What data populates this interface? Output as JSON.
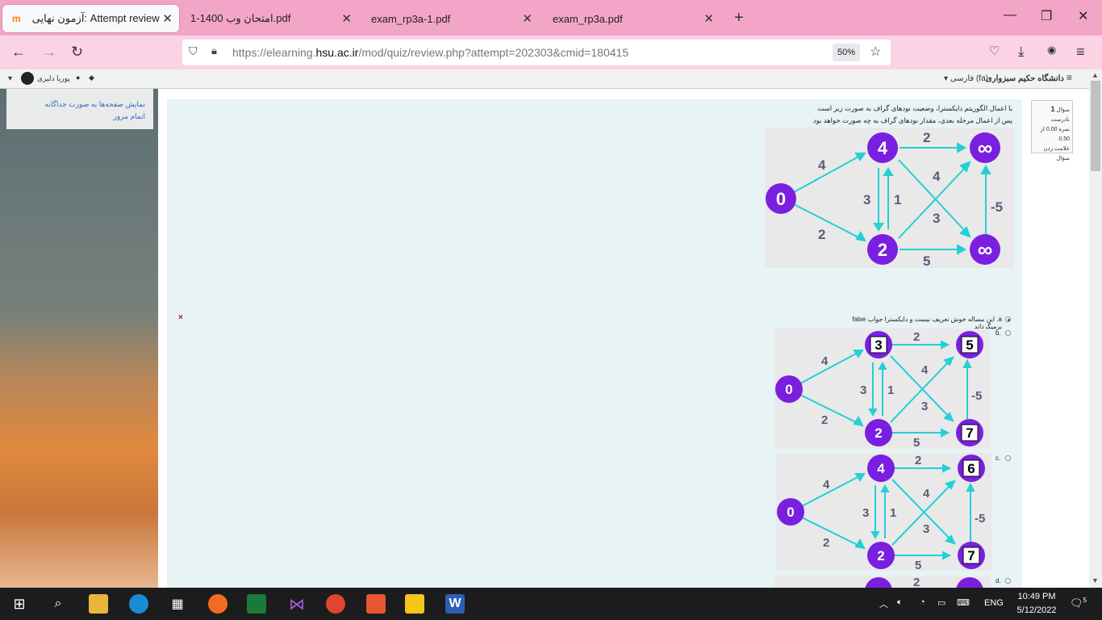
{
  "browser": {
    "tabs": [
      {
        "title": "Attempt review :آزمون نهایی",
        "active": true
      },
      {
        "title": "امتحان وب 1400-1.pdf",
        "active": false
      },
      {
        "title": "exam_rp3a-1.pdf",
        "active": false
      },
      {
        "title": "exam_rp3a.pdf",
        "active": false
      }
    ],
    "url_prefix": "https://elearning.",
    "url_domain": "hsu.ac.ir",
    "url_rest": "/mod/quiz/review.php?attempt=202303&cmid=180415",
    "zoom": "50%"
  },
  "moodle": {
    "site_name": "دانشگاه حکیم سبزواری",
    "language": "فارسی (fa)",
    "user_name": "پوریا دلیری",
    "nav_links": [
      "نمایش صفحه‌ها به صورت جداگانه",
      "اتمام مرور"
    ]
  },
  "question": {
    "info_title": "سؤال",
    "info_number": "1",
    "info_status": "نادرست",
    "info_grade": "نمره 0.00 از 0.50",
    "info_flag": "علامت زدن سؤال",
    "text_line1": "با اعمال الگوریتم دایکسترا، وضعیت نودهای گراف به صورت زیر است",
    "text_line2": "پس از اعمال مرحله بعدی، مقدار نودهای گراف  به چه صورت خواهد بود",
    "graph": {
      "nodes": [
        "0",
        "4",
        "∞",
        "2",
        "∞"
      ],
      "edge_labels": [
        "4",
        "2",
        "2",
        "3",
        "1",
        "4",
        "3",
        "-5",
        "5"
      ]
    },
    "options": [
      {
        "letter": "a.",
        "text": "این مساله خوش تعریف نیست و دایکسترا جواب false برمیگرداند",
        "selected": true
      },
      {
        "letter": "b.",
        "nodes": [
          "0",
          "3",
          "5",
          "2",
          "7"
        ],
        "selected": false
      },
      {
        "letter": "c.",
        "nodes": [
          "0",
          "4",
          "6",
          "2",
          "7"
        ],
        "selected": false
      },
      {
        "letter": "d.",
        "selected": false
      }
    ],
    "wrong_mark": "×"
  },
  "taskbar": {
    "time": "10:49 PM",
    "date": "5/12/2022",
    "lang": "ENG",
    "notif_count": "5"
  }
}
